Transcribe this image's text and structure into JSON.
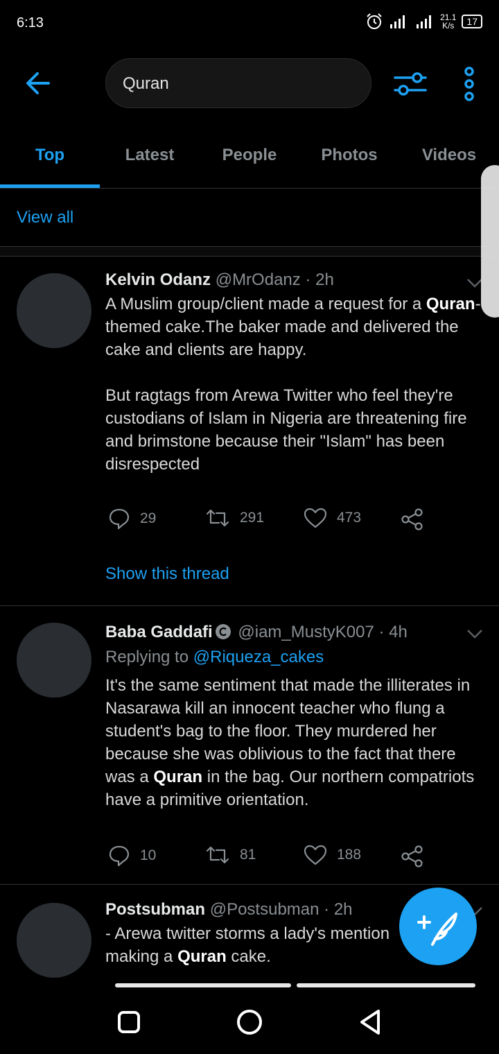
{
  "status": {
    "time": "6:13",
    "net_speed": "21.1",
    "net_unit": "K/s",
    "battery": "17"
  },
  "search": {
    "query": "Quran"
  },
  "tabs": [
    "Top",
    "Latest",
    "People",
    "Photos",
    "Videos"
  ],
  "active_tab": "Top",
  "view_all": "View all",
  "accent_color": "#1da1f2",
  "tweets": [
    {
      "name": "Kelvin Odanz",
      "handle": "@MrOdanz",
      "time": "· 2h",
      "body_p1_a": "A Muslim group/client made a request for a ",
      "body_p1_bold": "Quran",
      "body_p1_b": "-themed cake.The baker made and delivered the cake and clients are happy.",
      "body_p2": "But ragtags from Arewa Twitter who feel they're custodians of Islam in Nigeria are threatening fire and brimstone because their \"Islam\" has been disrespected",
      "replies": "29",
      "retweets": "291",
      "likes": "473",
      "show_thread": "Show this thread"
    },
    {
      "name": "Baba Gaddafi",
      "handle": "@iam_MustyK007",
      "time": "· 4h",
      "reply_prefix": "Replying to ",
      "reply_handle": "@Riqueza_cakes",
      "body_a": "It's the same sentiment that made the illiterates in Nasarawa kill an innocent teacher who flung a student's bag to the floor. They murdered her because she was oblivious to the fact that there was a ",
      "body_bold": "Quran",
      "body_b": " in the bag. Our northern compatriots have a primitive orientation.",
      "replies": "10",
      "retweets": "81",
      "likes": "188"
    },
    {
      "name": "Postsubman",
      "handle": "@Postsubman",
      "time": "· 2h",
      "body_a": "- Arewa twitter storms a lady's mention",
      "body_b": "making a ",
      "body_bold": "Quran",
      "body_c": " cake."
    }
  ]
}
